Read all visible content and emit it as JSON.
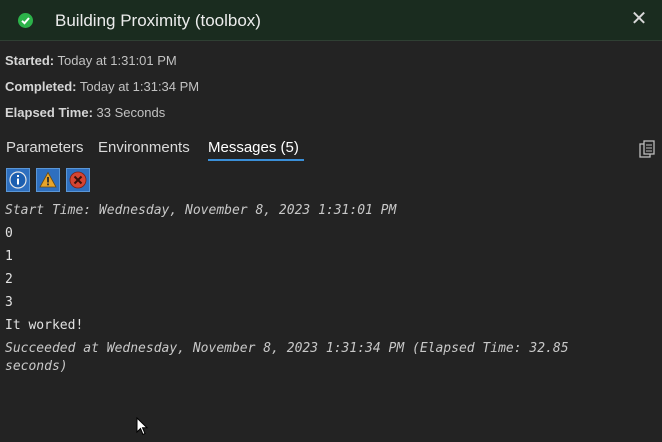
{
  "header": {
    "title": "Building Proximity (toolbox)",
    "status_icon": "success-check-icon",
    "close_glyph": "✕"
  },
  "info": {
    "started_label": "Started:",
    "started_value": "Today at 1:31:01 PM",
    "completed_label": "Completed:",
    "completed_value": "Today at 1:31:34 PM",
    "elapsed_label": "Elapsed Time:",
    "elapsed_value": "33 Seconds"
  },
  "tabs": [
    {
      "label": "Parameters"
    },
    {
      "label": "Environments"
    },
    {
      "label": "Messages (5)",
      "active": true
    }
  ],
  "filters": [
    {
      "icon": "info-filter-icon"
    },
    {
      "icon": "warning-filter-icon"
    },
    {
      "icon": "error-filter-icon"
    }
  ],
  "messages": [
    "Start Time: Wednesday, November 8, 2023 1:31:01 PM",
    "0",
    "1",
    "2",
    "3",
    "It worked!",
    "Succeeded at Wednesday, November 8, 2023 1:31:34 PM (Elapsed Time: 32.85",
    "seconds)"
  ],
  "colors": {
    "background": "#232323",
    "titlebar": "#1a2c1f",
    "success": "#2cb34a",
    "accent": "#3a8fd8"
  }
}
